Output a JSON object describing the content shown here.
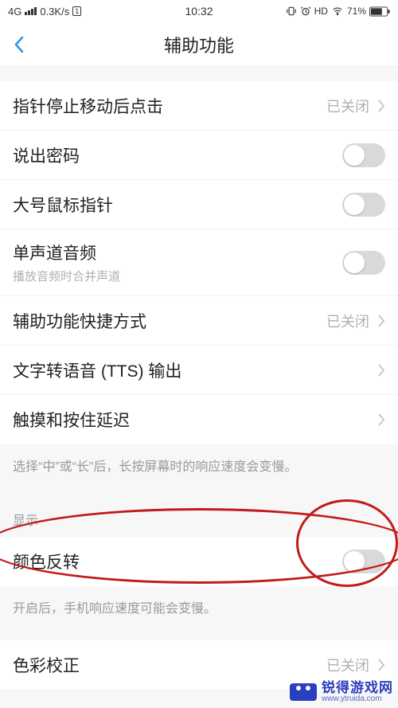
{
  "status": {
    "network": "4G",
    "speed": "0.3K/s",
    "sim": "1",
    "time": "10:32",
    "hd": "HD",
    "battery": "71%"
  },
  "header": {
    "title": "辅助功能"
  },
  "rows": {
    "pointer_click": {
      "label": "指针停止移动后点击",
      "value": "已关闭"
    },
    "speak_pw": {
      "label": "说出密码"
    },
    "large_cursor": {
      "label": "大号鼠标指针"
    },
    "mono_audio": {
      "label": "单声道音频",
      "sub": "播放音频时合并声道"
    },
    "shortcut": {
      "label": "辅助功能快捷方式",
      "value": "已关闭"
    },
    "tts": {
      "label": "文字转语音 (TTS) 输出"
    },
    "touch_hold": {
      "label": "触摸和按住延迟"
    },
    "invert": {
      "label": "颜色反转"
    },
    "color_correct": {
      "label": "色彩校正",
      "value": "已关闭"
    }
  },
  "notes": {
    "touch_hold_note": "选择“中”或“长”后，长按屏幕时的响应速度会变慢。",
    "display_header": "显示",
    "invert_note": "开启后，手机响应速度可能会变慢。"
  },
  "watermark": {
    "cn": "锐得游戏网",
    "url": "www.ytruida.com"
  }
}
